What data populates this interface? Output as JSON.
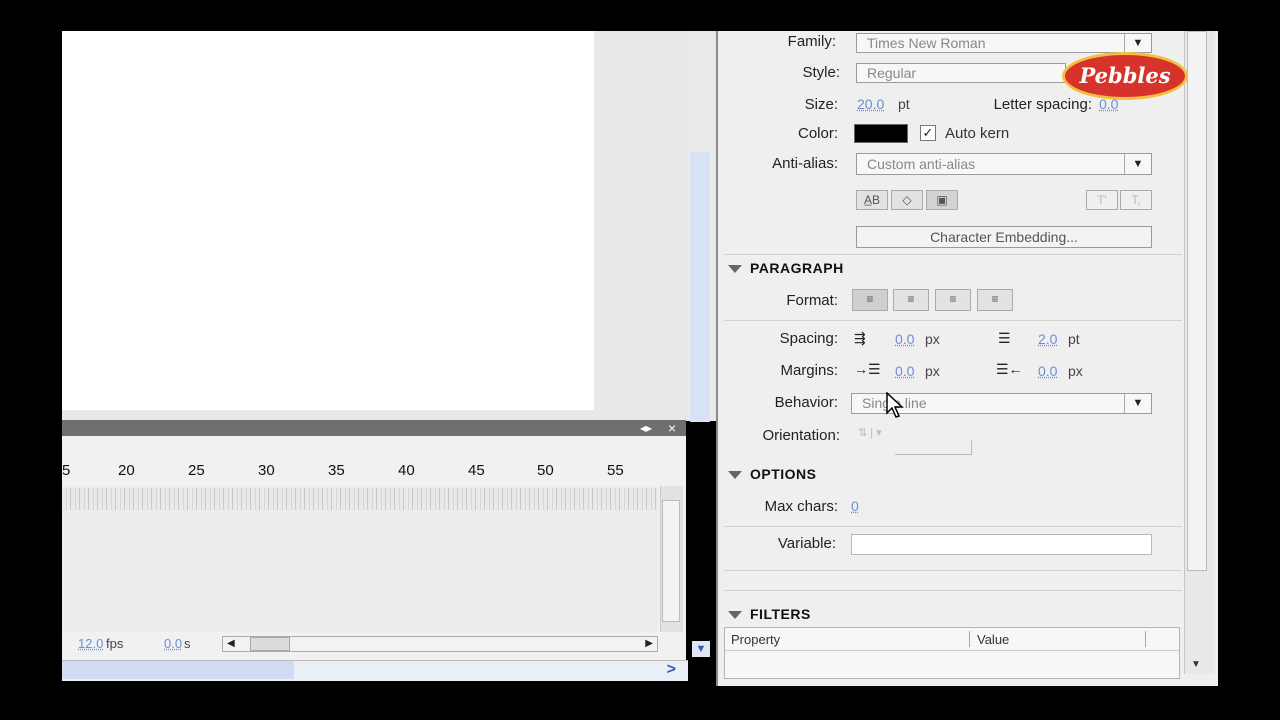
{
  "brand": {
    "logo_text": "Pebbles"
  },
  "timeline": {
    "ruler": [
      "5",
      "20",
      "25",
      "30",
      "35",
      "40",
      "45",
      "50",
      "55"
    ],
    "fps_value": "12.0",
    "fps_unit": "fps",
    "time_value": "0.0",
    "time_unit": "s",
    "scroll_left": "◀",
    "scroll_right": "▶",
    "panel_arrows": "◂▸",
    "close": "×",
    "bottom_arrow": ">"
  },
  "character": {
    "family_label": "Family:",
    "family_value": "Times New Roman",
    "style_label": "Style:",
    "style_value": "Regular",
    "size_label": "Size:",
    "size_value": "20.0",
    "size_unit": "pt",
    "letter_spacing_label": "Letter spacing:",
    "letter_spacing_value": "0.0",
    "color_label": "Color:",
    "color_value": "#000000",
    "auto_kern_label": "Auto kern",
    "anti_alias_label": "Anti-alias:",
    "anti_alias_value": "Custom anti-alias",
    "embedding_button": "Character Embedding..."
  },
  "paragraph": {
    "title": "PARAGRAPH",
    "format_label": "Format:",
    "spacing_label": "Spacing:",
    "spacing_indent": "0.0",
    "spacing_indent_unit": "px",
    "spacing_line": "2.0",
    "spacing_line_unit": "pt",
    "margins_label": "Margins:",
    "margin_left": "0.0",
    "margin_left_unit": "px",
    "margin_right": "0.0",
    "margin_right_unit": "px",
    "behavior_label": "Behavior:",
    "behavior_value": "Single line",
    "orientation_label": "Orientation:"
  },
  "options": {
    "title": "OPTIONS",
    "max_chars_label": "Max chars:",
    "max_chars_value": "0",
    "variable_label": "Variable:",
    "variable_value": ""
  },
  "filters": {
    "title": "FILTERS",
    "col_property": "Property",
    "col_value": "Value"
  }
}
